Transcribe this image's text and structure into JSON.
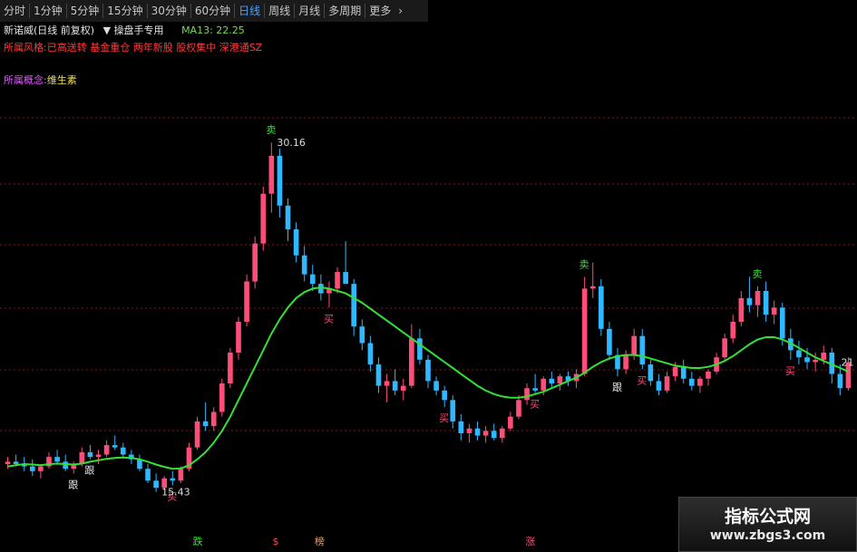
{
  "toolbar": {
    "buttons": [
      {
        "label": "分时",
        "active": false
      },
      {
        "label": "1分钟",
        "active": false
      },
      {
        "label": "5分钟",
        "active": false
      },
      {
        "label": "15分钟",
        "active": false
      },
      {
        "label": "30分钟",
        "active": false
      },
      {
        "label": "60分钟",
        "active": false
      },
      {
        "label": "日线",
        "active": true
      },
      {
        "label": "周线",
        "active": false
      },
      {
        "label": "月线",
        "active": false
      },
      {
        "label": "多周期",
        "active": false
      },
      {
        "label": "更多",
        "active": false
      }
    ]
  },
  "info": {
    "stock_name": "新诺威(日线 前复权)",
    "tool_label": "操盘手专用",
    "ma_label": "MA13: 22.25"
  },
  "tags_line": "所属风格:已高送转 基金重仓 两年新股 股权集中 深港通SZ",
  "concept": {
    "key": "所属概念:",
    "value": "维生素"
  },
  "chart_data": {
    "type": "candlestick",
    "price_high_label": "30.16",
    "price_low_label": "15.43",
    "price_last_label": "21",
    "colors": {
      "up": "#ff4d79",
      "down": "#2fb8ff",
      "ma": "#33e033",
      "grid": "#8b1414"
    },
    "candles_ohlc": [
      [
        16.6,
        16.9,
        16.4,
        16.7
      ],
      [
        16.7,
        17.0,
        16.5,
        16.6
      ],
      [
        16.6,
        16.9,
        16.3,
        16.5
      ],
      [
        16.5,
        16.8,
        16.1,
        16.3
      ],
      [
        16.3,
        16.6,
        16.0,
        16.5
      ],
      [
        16.5,
        17.1,
        16.4,
        16.9
      ],
      [
        16.9,
        17.2,
        16.6,
        16.7
      ],
      [
        16.7,
        17.0,
        16.3,
        16.4
      ],
      [
        16.4,
        16.7,
        16.2,
        16.6
      ],
      [
        16.6,
        17.3,
        16.5,
        17.1
      ],
      [
        17.1,
        17.4,
        16.8,
        16.9
      ],
      [
        16.9,
        17.2,
        16.6,
        17.0
      ],
      [
        17.0,
        17.6,
        16.9,
        17.4
      ],
      [
        17.4,
        17.8,
        17.2,
        17.3
      ],
      [
        17.3,
        17.5,
        16.9,
        17.0
      ],
      [
        17.0,
        17.2,
        16.6,
        16.8
      ],
      [
        16.8,
        17.0,
        16.3,
        16.4
      ],
      [
        16.4,
        16.6,
        15.8,
        15.9
      ],
      [
        15.9,
        16.2,
        15.43,
        15.6
      ],
      [
        15.6,
        16.1,
        15.5,
        16.0
      ],
      [
        16.0,
        16.3,
        15.7,
        15.9
      ],
      [
        15.9,
        16.5,
        15.8,
        16.4
      ],
      [
        16.4,
        17.5,
        16.3,
        17.3
      ],
      [
        17.3,
        18.6,
        17.2,
        18.4
      ],
      [
        18.4,
        19.2,
        18.0,
        18.2
      ],
      [
        18.2,
        19.0,
        18.0,
        18.8
      ],
      [
        18.8,
        20.2,
        18.6,
        20.0
      ],
      [
        20.0,
        21.5,
        19.8,
        21.3
      ],
      [
        21.3,
        22.8,
        21.0,
        22.6
      ],
      [
        22.6,
        24.6,
        22.4,
        24.3
      ],
      [
        24.3,
        26.2,
        24.0,
        25.9
      ],
      [
        25.9,
        28.3,
        25.6,
        28.0
      ],
      [
        28.0,
        30.16,
        27.2,
        29.6
      ],
      [
        29.6,
        29.9,
        27.0,
        27.5
      ],
      [
        27.5,
        27.8,
        26.0,
        26.5
      ],
      [
        26.5,
        26.8,
        25.1,
        25.4
      ],
      [
        25.4,
        25.8,
        24.3,
        24.6
      ],
      [
        24.6,
        25.0,
        23.9,
        24.2
      ],
      [
        24.2,
        24.6,
        23.5,
        23.8
      ],
      [
        23.8,
        24.3,
        23.2,
        24.0
      ],
      [
        24.0,
        24.9,
        23.8,
        24.7
      ],
      [
        24.7,
        26.0,
        24.5,
        24.2
      ],
      [
        24.2,
        24.4,
        22.0,
        22.4
      ],
      [
        22.4,
        22.7,
        21.4,
        21.7
      ],
      [
        21.7,
        22.0,
        20.5,
        20.8
      ],
      [
        20.8,
        21.1,
        19.6,
        19.9
      ],
      [
        19.9,
        20.4,
        19.2,
        20.1
      ],
      [
        20.1,
        20.6,
        19.5,
        19.7
      ],
      [
        19.7,
        20.2,
        19.3,
        19.9
      ],
      [
        19.9,
        22.5,
        19.8,
        21.9
      ],
      [
        21.9,
        22.3,
        20.8,
        21.0
      ],
      [
        21.0,
        21.2,
        19.8,
        20.1
      ],
      [
        20.1,
        20.3,
        19.5,
        19.7
      ],
      [
        19.7,
        19.9,
        19.0,
        19.3
      ],
      [
        19.3,
        19.5,
        18.1,
        18.4
      ],
      [
        18.4,
        18.7,
        17.6,
        17.9
      ],
      [
        17.9,
        18.3,
        17.5,
        18.1
      ],
      [
        18.1,
        18.4,
        17.6,
        17.8
      ],
      [
        17.8,
        18.2,
        17.5,
        18.0
      ],
      [
        18.0,
        18.3,
        17.6,
        17.7
      ],
      [
        17.7,
        18.2,
        17.5,
        18.1
      ],
      [
        18.1,
        18.8,
        18.0,
        18.6
      ],
      [
        18.6,
        19.5,
        18.5,
        19.3
      ],
      [
        19.3,
        20.0,
        19.1,
        19.8
      ],
      [
        19.8,
        20.4,
        19.6,
        19.7
      ],
      [
        19.7,
        20.3,
        19.5,
        20.2
      ],
      [
        20.2,
        20.5,
        19.8,
        20.0
      ],
      [
        20.0,
        20.4,
        19.7,
        20.3
      ],
      [
        20.3,
        20.5,
        19.9,
        20.1
      ],
      [
        20.1,
        20.6,
        19.8,
        20.4
      ],
      [
        20.4,
        24.5,
        20.3,
        24.0
      ],
      [
        24.0,
        25.1,
        23.6,
        24.1
      ],
      [
        24.1,
        24.4,
        22.0,
        22.3
      ],
      [
        22.3,
        22.6,
        21.0,
        21.2
      ],
      [
        21.2,
        21.5,
        20.3,
        20.6
      ],
      [
        20.6,
        21.4,
        20.4,
        21.2
      ],
      [
        21.2,
        22.3,
        21.0,
        22.0
      ],
      [
        22.0,
        22.3,
        20.6,
        20.8
      ],
      [
        20.8,
        21.0,
        19.9,
        20.1
      ],
      [
        20.1,
        20.4,
        19.5,
        19.7
      ],
      [
        19.7,
        20.5,
        19.6,
        20.3
      ],
      [
        20.3,
        20.9,
        20.1,
        20.7
      ],
      [
        20.7,
        21.0,
        20.0,
        20.2
      ],
      [
        20.2,
        20.5,
        19.7,
        19.9
      ],
      [
        19.9,
        20.3,
        19.6,
        20.2
      ],
      [
        20.2,
        20.6,
        19.9,
        20.5
      ],
      [
        20.5,
        21.3,
        20.4,
        21.1
      ],
      [
        21.1,
        22.1,
        21.0,
        21.9
      ],
      [
        21.9,
        22.9,
        21.7,
        22.6
      ],
      [
        22.6,
        23.9,
        22.4,
        23.6
      ],
      [
        23.6,
        24.5,
        23.0,
        23.3
      ],
      [
        23.3,
        24.1,
        22.8,
        23.9
      ],
      [
        23.9,
        24.3,
        22.6,
        22.9
      ],
      [
        22.9,
        23.5,
        22.5,
        23.2
      ],
      [
        23.2,
        23.4,
        21.6,
        21.9
      ],
      [
        21.9,
        22.3,
        21.0,
        21.4
      ],
      [
        21.4,
        21.8,
        20.8,
        21.1
      ],
      [
        21.1,
        21.5,
        20.6,
        20.9
      ],
      [
        20.9,
        21.3,
        20.5,
        21.0
      ],
      [
        21.0,
        21.6,
        20.8,
        21.3
      ],
      [
        21.3,
        21.5,
        20.0,
        20.4
      ],
      [
        20.4,
        20.8,
        19.5,
        19.8
      ],
      [
        19.8,
        21.1,
        19.7,
        20.9
      ]
    ],
    "ma_values": [
      16.5,
      16.55,
      16.6,
      16.58,
      16.55,
      16.6,
      16.62,
      16.6,
      16.58,
      16.62,
      16.7,
      16.76,
      16.82,
      16.86,
      16.88,
      16.86,
      16.8,
      16.7,
      16.58,
      16.48,
      16.4,
      16.42,
      16.55,
      16.8,
      17.1,
      17.5,
      18.0,
      18.6,
      19.3,
      20.0,
      20.7,
      21.4,
      22.1,
      22.7,
      23.2,
      23.6,
      23.85,
      24.0,
      24.05,
      24.0,
      23.9,
      23.8,
      23.6,
      23.4,
      23.15,
      22.9,
      22.65,
      22.4,
      22.15,
      21.9,
      21.65,
      21.4,
      21.15,
      20.9,
      20.65,
      20.4,
      20.15,
      19.9,
      19.7,
      19.55,
      19.45,
      19.4,
      19.4,
      19.45,
      19.55,
      19.65,
      19.8,
      19.95,
      20.1,
      20.25,
      20.45,
      20.7,
      20.9,
      21.05,
      21.15,
      21.2,
      21.2,
      21.15,
      21.05,
      20.95,
      20.85,
      20.75,
      20.7,
      20.65,
      20.65,
      20.7,
      20.8,
      20.95,
      21.15,
      21.4,
      21.65,
      21.85,
      21.95,
      21.95,
      21.85,
      21.7,
      21.5,
      21.3,
      21.1,
      20.95,
      20.8,
      20.65,
      20.5
    ],
    "signals": [
      {
        "text": "卖",
        "i": 32,
        "where": "above",
        "color": "#33e033"
      },
      {
        "text": "买",
        "i": 39,
        "where": "below",
        "color": "#ff4d79"
      },
      {
        "text": "买",
        "i": 53,
        "where": "below",
        "color": "#ff4d79"
      },
      {
        "text": "买",
        "i": 64,
        "where": "below",
        "color": "#ff4d79"
      },
      {
        "text": "卖",
        "i": 70,
        "where": "above",
        "color": "#33e033"
      },
      {
        "text": "跟",
        "i": 74,
        "where": "below",
        "color": "#e6e6e6"
      },
      {
        "text": "买",
        "i": 77,
        "where": "below",
        "color": "#ff4d79"
      },
      {
        "text": "卖",
        "i": 91,
        "where": "above",
        "color": "#33e033"
      },
      {
        "text": "买",
        "i": 95,
        "where": "below",
        "color": "#ff4d79"
      },
      {
        "text": "跟",
        "i": 8,
        "where": "below",
        "color": "#e6e6e6"
      },
      {
        "text": "跟",
        "i": 10,
        "where": "below",
        "color": "#e6e6e6"
      },
      {
        "text": "买",
        "i": 20,
        "where": "below",
        "color": "#ff4d79"
      }
    ],
    "bottom_labels": [
      {
        "text": "跌",
        "color": "#33e033",
        "x_frac": 0.225
      },
      {
        "text": "$",
        "color": "#ff4d4d",
        "x_frac": 0.318
      },
      {
        "text": "榜",
        "color": "#ff9b4d",
        "x_frac": 0.367
      },
      {
        "text": "涨",
        "color": "#ff4d79",
        "x_frac": 0.613
      }
    ],
    "ylim": [
      14.0,
      32.5
    ]
  },
  "watermark": {
    "title": "指标公式网",
    "url": "www.zbgs3.com"
  }
}
